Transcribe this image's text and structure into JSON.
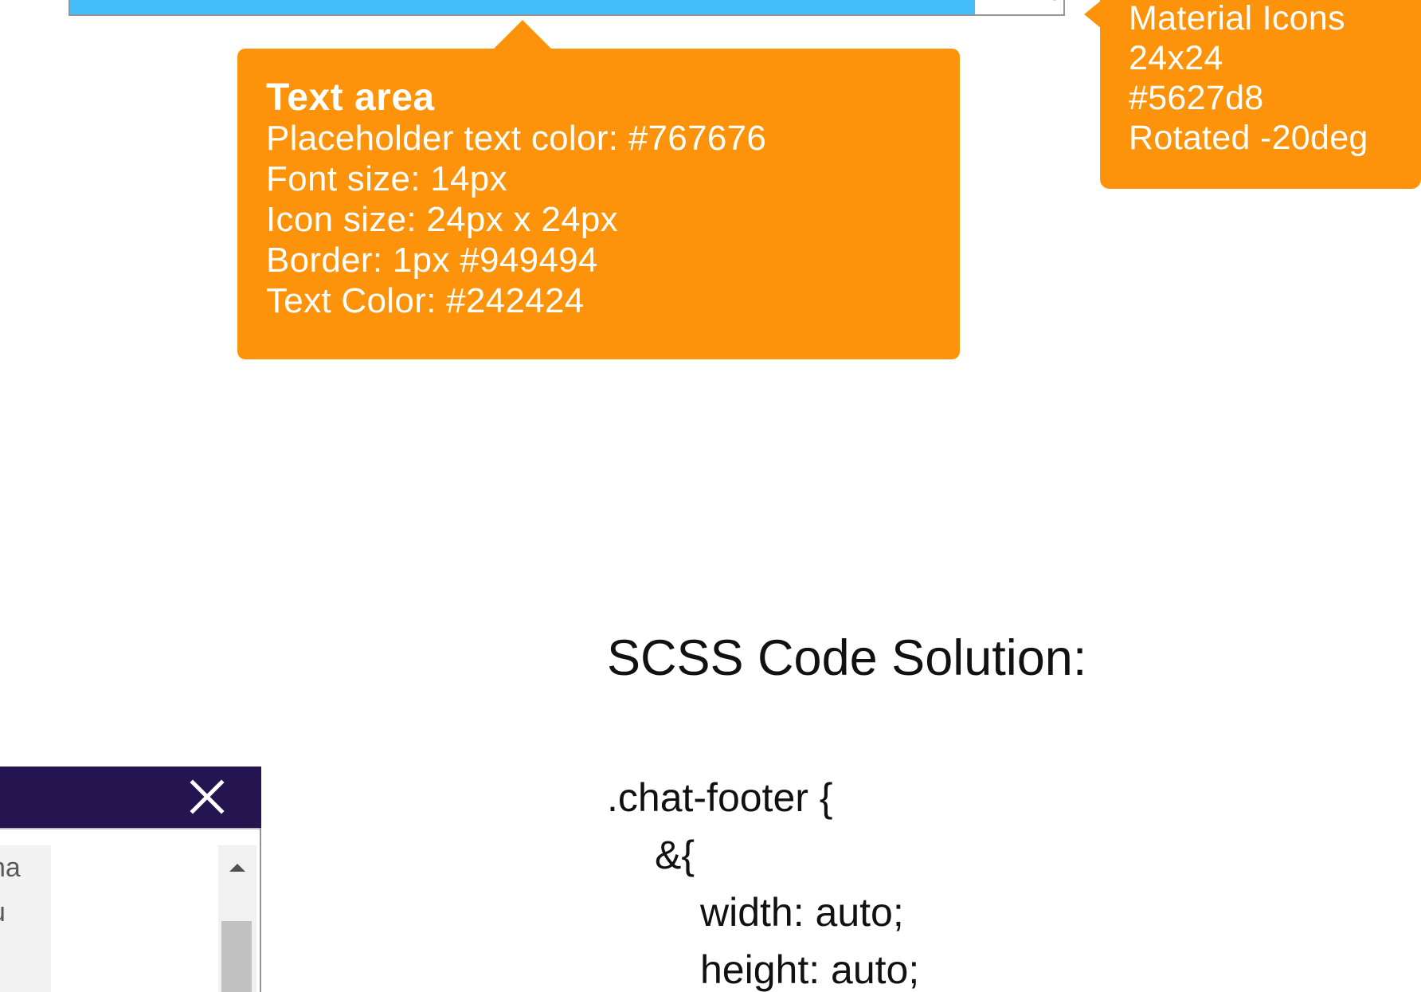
{
  "textarea_callout": {
    "title": "Text area",
    "lines": [
      "Placeholder text color: #767676",
      "Font size: 14px",
      "Icon size: 24px x 24px",
      "Border: 1px #949494",
      "Text Color: #242424"
    ]
  },
  "icon_callout": {
    "lines": [
      "Material Icons",
      "24x24",
      "#5627d8",
      "Rotated -20deg"
    ]
  },
  "scss": {
    "heading": "SCSS Code Solution:",
    "code_lines": [
      ".chat-footer {",
      "&{",
      "width: auto;",
      "height: auto;"
    ]
  },
  "chat_widget": {
    "close_icon": "close-icon",
    "messages": [
      "na",
      "u"
    ],
    "scroll_up_icon": "arrow-up-icon"
  },
  "colors": {
    "callout": "#fc930a",
    "textarea_fill": "#45bdf9",
    "chat_header": "#24144f",
    "border": "#949494"
  }
}
